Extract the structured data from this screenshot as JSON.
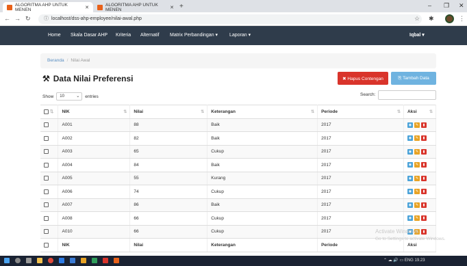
{
  "browser": {
    "tabs": [
      {
        "title": "ALGORITMA AHP UNTUK MENEN",
        "active": true
      },
      {
        "title": "ALGORITMA AHP UNTUK MENEN",
        "active": false
      }
    ],
    "url": "localhost/dss-ahp-employee/nilai-awal.php"
  },
  "navbar": {
    "items": [
      "Home",
      "Skala Dasar AHP",
      "Kriteria",
      "Alternatif",
      "Matrix Perbandingan ▾",
      "Laporan ▾"
    ],
    "user": "Iqbal ▾"
  },
  "breadcrumb": {
    "home": "Beranda",
    "current": "Nilai Awal"
  },
  "page": {
    "title": "Data Nilai Preferensi",
    "delete_label": "✖ Hapus Contengan",
    "add_label": "⎘ Tambah Data"
  },
  "controls": {
    "show": "Show",
    "entries_value": "10",
    "entries": "entries",
    "search": "Search:"
  },
  "table": {
    "headers": [
      "NIK",
      "Nilai",
      "Keterangan",
      "Periode",
      "Aksi"
    ],
    "rows": [
      [
        "A001",
        "88",
        "Baik",
        "2017"
      ],
      [
        "A002",
        "82",
        "Baik",
        "2017"
      ],
      [
        "A003",
        "65",
        "Cukup",
        "2017"
      ],
      [
        "A004",
        "84",
        "Baik",
        "2017"
      ],
      [
        "A005",
        "55",
        "Kurang",
        "2017"
      ],
      [
        "A006",
        "74",
        "Cukup",
        "2017"
      ],
      [
        "A007",
        "86",
        "Baik",
        "2017"
      ],
      [
        "A008",
        "66",
        "Cukup",
        "2017"
      ],
      [
        "A010",
        "66",
        "Cukup",
        "2017"
      ]
    ]
  },
  "watermark": {
    "line1": "Activate Windows",
    "line2": "Go to Settings to activate Windows."
  },
  "taskbar": {
    "lang": "ENG",
    "time": "19.23"
  }
}
